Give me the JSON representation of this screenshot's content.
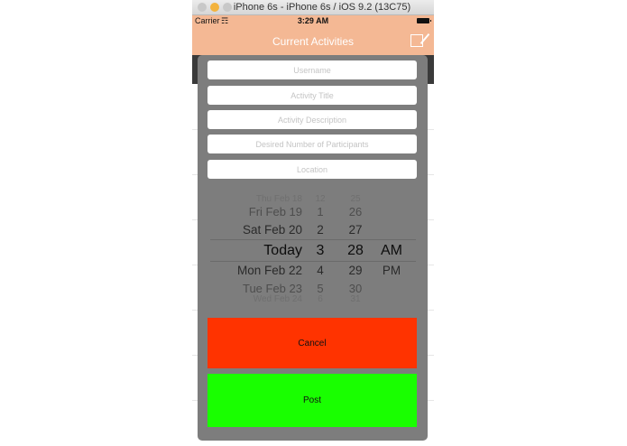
{
  "window": {
    "title": "iPhone 6s - iPhone 6s / iOS 9.2 (13C75)"
  },
  "status_bar": {
    "carrier": "Carrier",
    "time": "3:29 AM"
  },
  "nav": {
    "title": "Current Activities"
  },
  "form": {
    "username_placeholder": "Username",
    "title_placeholder": "Activity Title",
    "description_placeholder": "Activity Description",
    "participants_placeholder": "Desired Number of Participants",
    "location_placeholder": "Location"
  },
  "picker": {
    "rows": [
      {
        "date": "Thu Feb 18",
        "hour": "12",
        "minute": "25",
        "ampm": ""
      },
      {
        "date": "Fri Feb 19",
        "hour": "1",
        "minute": "26",
        "ampm": ""
      },
      {
        "date": "Sat Feb 20",
        "hour": "2",
        "minute": "27",
        "ampm": ""
      },
      {
        "date": "Today",
        "hour": "3",
        "minute": "28",
        "ampm": "AM"
      },
      {
        "date": "Mon Feb 22",
        "hour": "4",
        "minute": "29",
        "ampm": "PM"
      },
      {
        "date": "Tue Feb 23",
        "hour": "5",
        "minute": "30",
        "ampm": ""
      },
      {
        "date": "Wed Feb 24",
        "hour": "6",
        "minute": "31",
        "ampm": ""
      }
    ]
  },
  "buttons": {
    "cancel": "Cancel",
    "post": "Post"
  },
  "colors": {
    "nav": "#f4b894",
    "modal": "#7d7d7d",
    "cancel": "#ff3300",
    "post": "#19ff00"
  }
}
